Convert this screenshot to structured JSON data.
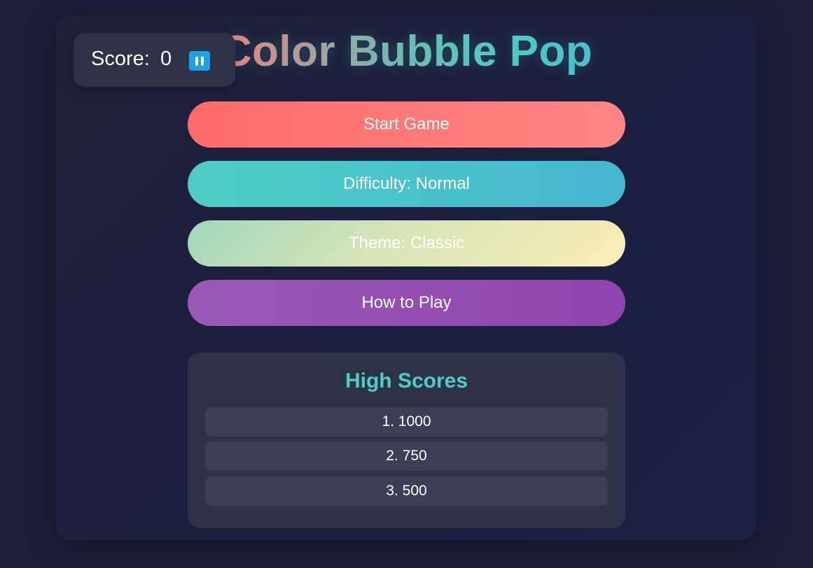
{
  "title": "Color Bubble Pop",
  "score": {
    "label": "Score:",
    "value": "0",
    "pause_icon": "pause-icon"
  },
  "menu": {
    "start": "Start Game",
    "difficulty": "Difficulty: Normal",
    "theme": "Theme: Classic",
    "how_to_play": "How to Play"
  },
  "high_scores": {
    "title": "High Scores",
    "entries": [
      "1. 1000",
      "2. 750",
      "3. 500"
    ]
  },
  "colors": {
    "background": "#1b1f3a",
    "accent": "#4ecdc4",
    "start": "#ff6b6b",
    "difficulty": "#45b7d1",
    "theme": "#fbedb6",
    "how_to_play": "#9b59b6",
    "pause_button": "#1aa1e6"
  }
}
